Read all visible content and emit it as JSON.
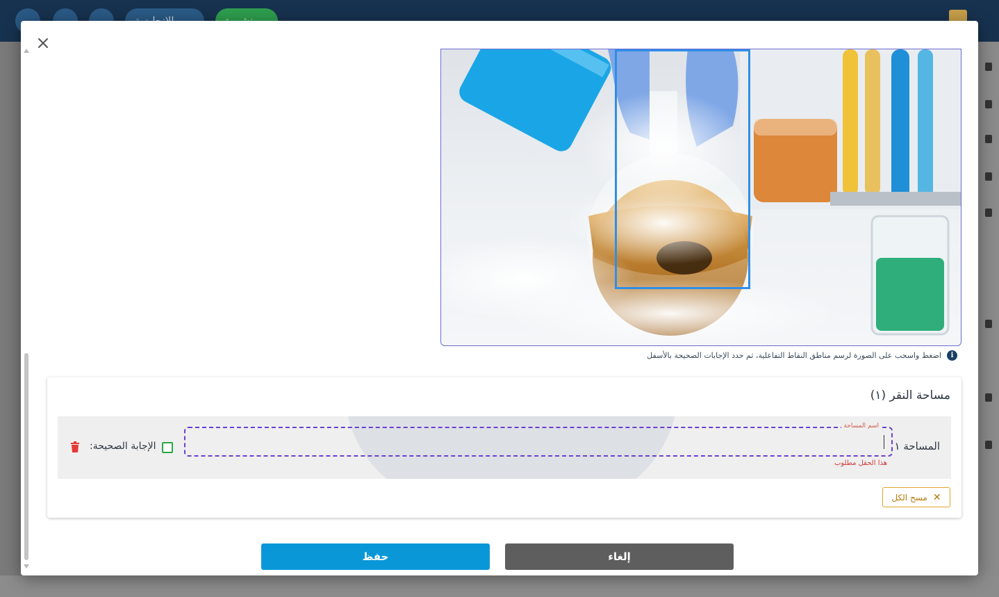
{
  "background": {
    "topbar_pills": [
      "الإنجليزية",
      "منشورة"
    ]
  },
  "modal": {
    "close_icon": "close-icon",
    "hint_text": "اضغط واسحب على الصورة لرسم مناطق النقاط التفاعلية، ثم حدد الإجابات الصحيحة بالأسفل",
    "card": {
      "title": "مساحة النقر (١)",
      "row": {
        "label": "المساحة ١",
        "input_floating_label": "اسم المساحة",
        "input_value": "",
        "error_text": "هذا الحقل مطلوب",
        "correct_answer_label": "الإجابة الصحيحة:",
        "correct_checked": false
      },
      "clear_all_label": "مسح الكل"
    },
    "buttons": {
      "save": "حفظ",
      "cancel": "إلغاء"
    }
  },
  "colors": {
    "primary": "#0a97d8",
    "cancel": "#5e5e5e",
    "hotspot": "#2f8ee8",
    "error": "#d03b3b",
    "warning": "#e0a52a",
    "success": "#28a745"
  }
}
